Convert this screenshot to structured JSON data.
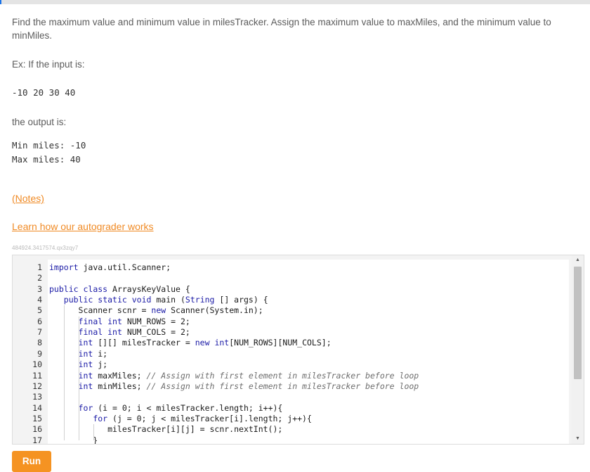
{
  "problem": {
    "statement": "Find the maximum value and minimum value in milesTracker. Assign the maximum value to maxMiles, and the minimum value to minMiles.",
    "example_intro": "Ex: If the input is:",
    "example_input": "-10 20 30 40",
    "output_intro": "the output is:",
    "example_output_line1": "Min miles: -10",
    "example_output_line2": "Max miles: 40",
    "notes_link": "(Notes)",
    "autograder_link": "Learn how our autograder works",
    "problem_id": "484924.3417574.qx3zqy7"
  },
  "editor": {
    "lines": [
      {
        "n": "1",
        "text": "import java.util.Scanner;"
      },
      {
        "n": "2",
        "text": ""
      },
      {
        "n": "3",
        "text": "public class ArraysKeyValue {"
      },
      {
        "n": "4",
        "text": "   public static void main (String [] args) {"
      },
      {
        "n": "5",
        "text": "      Scanner scnr = new Scanner(System.in);"
      },
      {
        "n": "6",
        "text": "      final int NUM_ROWS = 2;"
      },
      {
        "n": "7",
        "text": "      final int NUM_COLS = 2;"
      },
      {
        "n": "8",
        "text": "      int [][] milesTracker = new int[NUM_ROWS][NUM_COLS];"
      },
      {
        "n": "9",
        "text": "      int i;"
      },
      {
        "n": "10",
        "text": "      int j;"
      },
      {
        "n": "11",
        "text": "      int maxMiles; // Assign with first element in milesTracker before loop"
      },
      {
        "n": "12",
        "text": "      int minMiles; // Assign with first element in milesTracker before loop"
      },
      {
        "n": "13",
        "text": ""
      },
      {
        "n": "14",
        "text": "      for (i = 0; i < milesTracker.length; i++){"
      },
      {
        "n": "15",
        "text": "         for (j = 0; j < milesTracker[i].length; j++){"
      },
      {
        "n": "16",
        "text": "            milesTracker[i][j] = scnr.nextInt();"
      },
      {
        "n": "17",
        "text": "         }"
      }
    ]
  },
  "run_button": {
    "label": "Run"
  },
  "colors": {
    "accent": "#f59322",
    "link": "#f08a24",
    "keyword": "#1a1aa6"
  }
}
